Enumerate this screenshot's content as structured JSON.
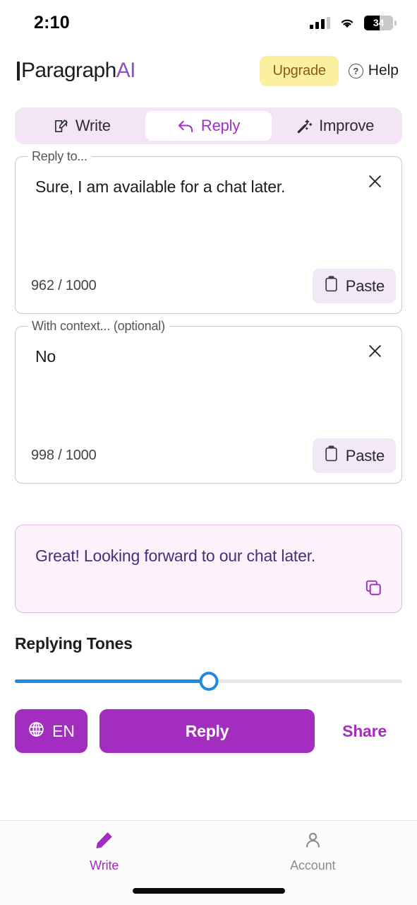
{
  "statusbar": {
    "time": "2:10",
    "battery_level": "34",
    "signal_icon": "cellular-signal-icon",
    "wifi_icon": "wifi-icon",
    "battery_icon": "battery-icon"
  },
  "header": {
    "logo_prefix": "Paragraph",
    "logo_suffix": "AI",
    "upgrade_label": "Upgrade",
    "help_label": "Help",
    "help_icon": "question-circle-icon",
    "upgrade_bg": "#fbf0a0",
    "upgrade_color": "#8a5a16"
  },
  "tabs": {
    "items": [
      {
        "label": "Write",
        "icon": "edit-square-icon",
        "active": false
      },
      {
        "label": "Reply",
        "icon": "reply-arrow-icon",
        "active": true
      },
      {
        "label": "Improve",
        "icon": "magic-wand-icon",
        "active": false
      }
    ],
    "active_color": "#a42fc4",
    "bg": "#f3e4f6"
  },
  "reply_to_field": {
    "legend": "Reply to...",
    "value": "Sure, I am available for a chat later.",
    "placeholder": "Reply to...",
    "char_count": "962 / 1000",
    "paste_label": "Paste",
    "paste_icon": "clipboard-icon",
    "close_icon": "close-x-icon"
  },
  "context_field": {
    "legend": "With context... (optional)",
    "value": "No",
    "placeholder": "With context... (optional)",
    "char_count": "998 / 1000",
    "paste_label": "Paste",
    "paste_icon": "clipboard-icon",
    "close_icon": "close-x-icon"
  },
  "result": {
    "text": "Great! Looking forward to our chat later.",
    "copy_icon": "copy-icon",
    "bg": "#fbf2fc",
    "border": "#ddb6e6",
    "text_color": "#4a2d7a"
  },
  "tones": {
    "title": "Replying Tones",
    "slider_percent": 50,
    "track_color": "#e8e8f2",
    "fill_color": "#1f8ae5"
  },
  "actions": {
    "language_label": "EN",
    "language_icon": "globe-icon",
    "reply_label": "Reply",
    "share_label": "Share",
    "primary_color": "#a32dbe"
  },
  "bottomnav": {
    "items": [
      {
        "label": "Write",
        "icon": "pencil-icon",
        "active": true
      },
      {
        "label": "Account",
        "icon": "person-icon",
        "active": false
      }
    ],
    "active_color": "#a32dbe",
    "inactive_color": "#8b8b92"
  }
}
